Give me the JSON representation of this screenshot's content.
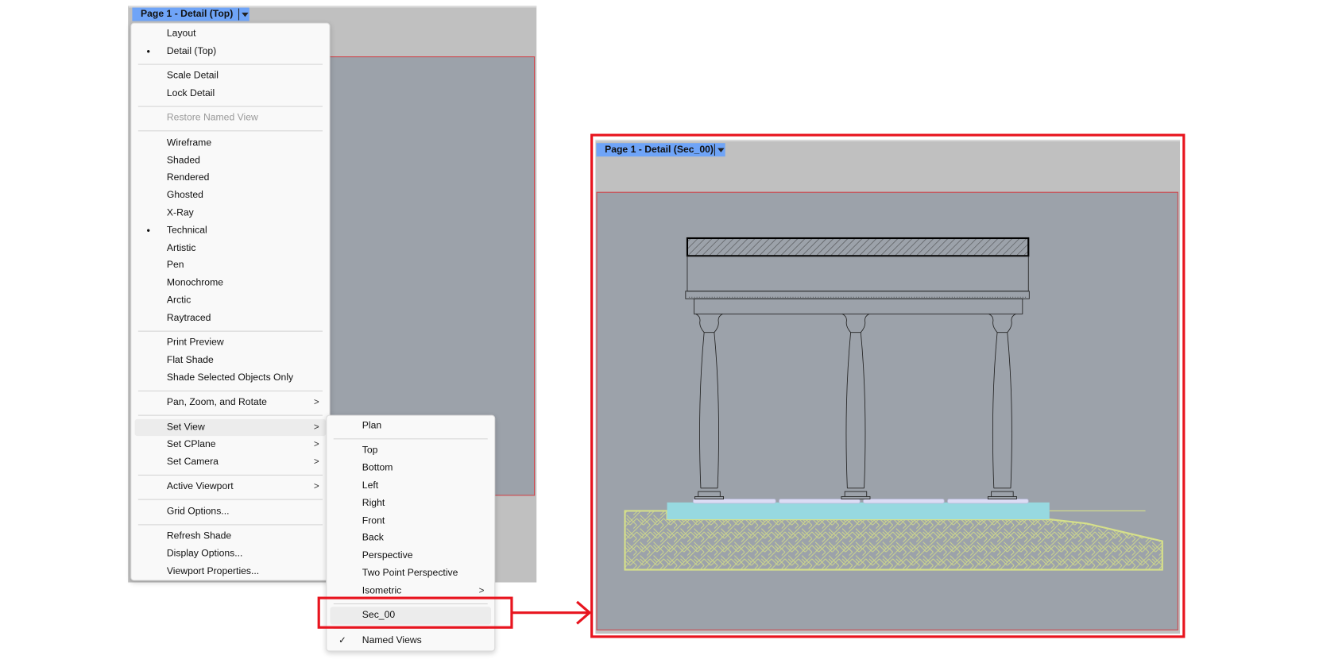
{
  "left_viewport": {
    "tab_label": "Page 1 - Detail (Top)"
  },
  "context_menu": [
    {
      "label": "Layout"
    },
    {
      "label": "Detail (Top)",
      "bullet": true
    },
    {
      "sep": true
    },
    {
      "label": "Scale Detail"
    },
    {
      "label": "Lock Detail"
    },
    {
      "sep": true
    },
    {
      "label": "Restore Named View",
      "disabled": true
    },
    {
      "sep": true
    },
    {
      "label": "Wireframe"
    },
    {
      "label": "Shaded"
    },
    {
      "label": "Rendered"
    },
    {
      "label": "Ghosted"
    },
    {
      "label": "X-Ray"
    },
    {
      "label": "Technical",
      "bullet": true
    },
    {
      "label": "Artistic"
    },
    {
      "label": "Pen"
    },
    {
      "label": "Monochrome"
    },
    {
      "label": "Arctic"
    },
    {
      "label": "Raytraced"
    },
    {
      "sep": true
    },
    {
      "label": "Print Preview"
    },
    {
      "label": "Flat Shade"
    },
    {
      "label": "Shade Selected Objects Only"
    },
    {
      "sep": true
    },
    {
      "label": "Pan, Zoom, and Rotate",
      "submenu": true
    },
    {
      "sep": true
    },
    {
      "label": "Set View",
      "submenu": true,
      "highlighted": true
    },
    {
      "label": "Set CPlane",
      "submenu": true
    },
    {
      "label": "Set Camera",
      "submenu": true
    },
    {
      "sep": true
    },
    {
      "label": "Active Viewport",
      "submenu": true
    },
    {
      "sep": true
    },
    {
      "label": "Grid Options..."
    },
    {
      "sep": true
    },
    {
      "label": "Refresh Shade"
    },
    {
      "label": "Display Options..."
    },
    {
      "label": "Viewport Properties..."
    }
  ],
  "set_view_submenu": [
    {
      "label": "Plan"
    },
    {
      "sep": true
    },
    {
      "label": "Top"
    },
    {
      "label": "Bottom"
    },
    {
      "label": "Left"
    },
    {
      "label": "Right"
    },
    {
      "label": "Front"
    },
    {
      "label": "Back"
    },
    {
      "label": "Perspective"
    },
    {
      "label": "Two Point Perspective"
    },
    {
      "label": "Isometric",
      "submenu": true
    },
    {
      "sep": true
    },
    {
      "label": "Sec_00",
      "highlighted": true
    },
    {
      "sep": true
    },
    {
      "label": "Named Views",
      "checked": true
    }
  ],
  "right_viewport": {
    "tab_label": "Page 1 - Detail (Sec_00)"
  },
  "colors": {
    "annotation_red": "#e8141e",
    "tab_blue": "#6fa4f7",
    "viewport_gray": "#9ca2aa",
    "plinth_cyan": "#97d9e0",
    "ground_yellow": "#d6e08a"
  }
}
